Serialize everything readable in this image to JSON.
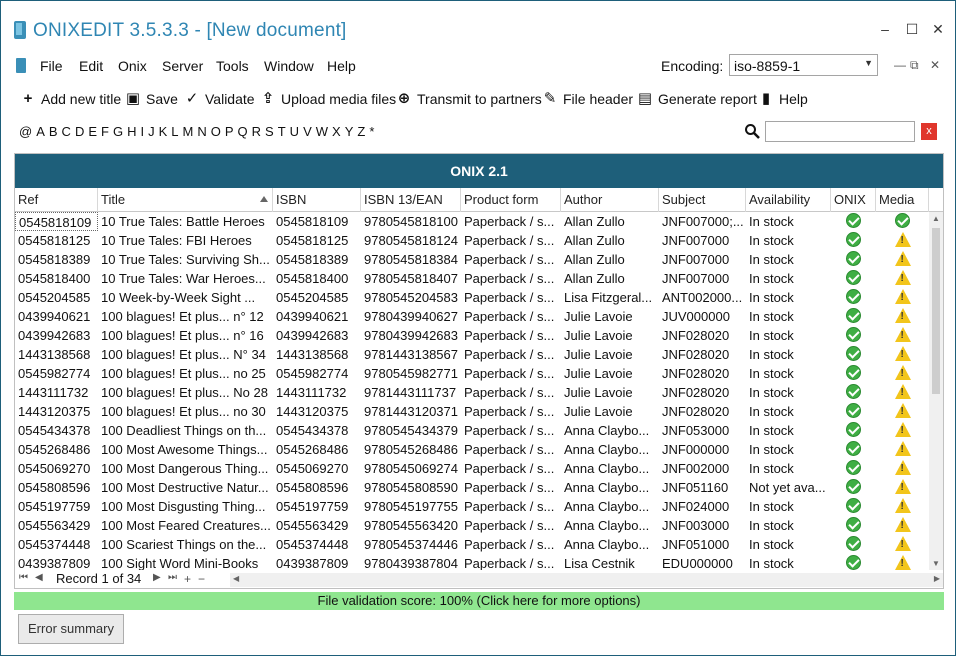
{
  "window": {
    "title": "ONIXEDIT 3.5.3.3 - [New document]",
    "min": "–",
    "max": "☐",
    "close": "✕"
  },
  "menu": [
    "File",
    "Edit",
    "Onix",
    "Server",
    "Tools",
    "Window",
    "Help"
  ],
  "encoding": {
    "label": "Encoding:",
    "value": "iso-8859-1"
  },
  "mdi": {
    "min": "—",
    "restore": "⧉",
    "close": "✕"
  },
  "toolbar": {
    "add": "Add new title",
    "save": "Save",
    "validate": "Validate",
    "upload": "Upload media files",
    "transmit": "Transmit to partners",
    "header": "File header",
    "report": "Generate report",
    "help": "Help"
  },
  "alphabet": [
    "@",
    "A",
    "B",
    "C",
    "D",
    "E",
    "F",
    "G",
    "H",
    "I",
    "J",
    "K",
    "L",
    "M",
    "N",
    "O",
    "P",
    "Q",
    "R",
    "S",
    "T",
    "U",
    "V",
    "W",
    "X",
    "Y",
    "Z",
    "*"
  ],
  "search": {
    "value": ""
  },
  "grid": {
    "banner": "ONIX 2.1",
    "columns": [
      "Ref",
      "Title",
      "ISBN",
      "ISBN 13/EAN",
      "Product form",
      "Author",
      "Subject",
      "Availability",
      "ONIX",
      "Media"
    ],
    "rows": [
      [
        "0545818109",
        "10 True Tales: Battle Heroes",
        "0545818109",
        "9780545818100",
        "Paperback / s...",
        "Allan Zullo",
        "JNF007000;...",
        "In stock",
        "ok",
        "ok"
      ],
      [
        "0545818125",
        "10 True Tales: FBI Heroes",
        "0545818125",
        "9780545818124",
        "Paperback / s...",
        "Allan Zullo",
        "JNF007000",
        "In stock",
        "ok",
        "warn"
      ],
      [
        "0545818389",
        "10 True Tales: Surviving Sh...",
        "0545818389",
        "9780545818384",
        "Paperback / s...",
        "Allan Zullo",
        "JNF007000",
        "In stock",
        "ok",
        "warn"
      ],
      [
        "0545818400",
        "10 True Tales: War Heroes...",
        "0545818400",
        "9780545818407",
        "Paperback / s...",
        "Allan Zullo",
        "JNF007000",
        "In stock",
        "ok",
        "warn"
      ],
      [
        "0545204585",
        "10 Week-by-Week Sight ...",
        "0545204585",
        "9780545204583",
        "Paperback / s...",
        "Lisa Fitzgeral...",
        "ANT002000...",
        "In stock",
        "ok",
        "warn"
      ],
      [
        "0439940621",
        "100 blagues! Et plus... n° 12",
        "0439940621",
        "9780439940627",
        "Paperback / s...",
        "Julie Lavoie",
        "JUV000000",
        "In stock",
        "ok",
        "warn"
      ],
      [
        "0439942683",
        "100 blagues! Et plus... n° 16",
        "0439942683",
        "9780439942683",
        "Paperback / s...",
        "Julie Lavoie",
        "JNF028020",
        "In stock",
        "ok",
        "warn"
      ],
      [
        "1443138568",
        "100 blagues! Et plus... N° 34",
        "1443138568",
        "9781443138567",
        "Paperback / s...",
        "Julie Lavoie",
        "JNF028020",
        "In stock",
        "ok",
        "warn"
      ],
      [
        "0545982774",
        "100 blagues! Et plus... no 25",
        "0545982774",
        "9780545982771",
        "Paperback / s...",
        "Julie Lavoie",
        "JNF028020",
        "In stock",
        "ok",
        "warn"
      ],
      [
        "1443111732",
        "100 blagues! Et plus... No 28",
        "1443111732",
        "9781443111737",
        "Paperback / s...",
        "Julie Lavoie",
        "JNF028020",
        "In stock",
        "ok",
        "warn"
      ],
      [
        "1443120375",
        "100 blagues! Et plus... no 30",
        "1443120375",
        "9781443120371",
        "Paperback / s...",
        "Julie Lavoie",
        "JNF028020",
        "In stock",
        "ok",
        "warn"
      ],
      [
        "0545434378",
        "100 Deadliest Things on th...",
        "0545434378",
        "9780545434379",
        "Paperback / s...",
        "Anna Claybo...",
        "JNF053000",
        "In stock",
        "ok",
        "warn"
      ],
      [
        "0545268486",
        "100 Most Awesome Things...",
        "0545268486",
        "9780545268486",
        "Paperback / s...",
        "Anna Claybo...",
        "JNF000000",
        "In stock",
        "ok",
        "warn"
      ],
      [
        "0545069270",
        "100 Most Dangerous Thing...",
        "0545069270",
        "9780545069274",
        "Paperback / s...",
        "Anna Claybo...",
        "JNF002000",
        "In stock",
        "ok",
        "warn"
      ],
      [
        "0545808596",
        "100 Most Destructive Natur...",
        "0545808596",
        "9780545808590",
        "Paperback / s...",
        "Anna Claybo...",
        "JNF051160",
        "Not yet ava...",
        "ok",
        "warn"
      ],
      [
        "0545197759",
        "100 Most Disgusting Thing...",
        "0545197759",
        "9780545197755",
        "Paperback / s...",
        "Anna Claybo...",
        "JNF024000",
        "In stock",
        "ok",
        "warn"
      ],
      [
        "0545563429",
        "100 Most Feared Creatures...",
        "0545563429",
        "9780545563420",
        "Paperback / s...",
        "Anna Claybo...",
        "JNF003000",
        "In stock",
        "ok",
        "warn"
      ],
      [
        "0545374448",
        "100 Scariest Things on the...",
        "0545374448",
        "9780545374446",
        "Paperback / s...",
        "Anna Claybo...",
        "JNF051000",
        "In stock",
        "ok",
        "warn"
      ],
      [
        "0439387809",
        "100 Sight Word Mini-Books",
        "0439387809",
        "9780439387804",
        "Paperback / s...",
        "Lisa Cestnik",
        "EDU000000",
        "In stock",
        "ok",
        "warn"
      ]
    ]
  },
  "navigator": {
    "record_label": "Record 1 of 34",
    "first": "⏮",
    "prev": "◀",
    "next": "▶",
    "last": "⏭",
    "add": "+",
    "remove": "−"
  },
  "status": {
    "text": "File validation score: 100%     (Click here for more options)"
  },
  "error_button": "Error summary",
  "colors": {
    "banner": "#1e5f7a",
    "title": "#2f86b3",
    "status_ok": "#8fe68f"
  }
}
